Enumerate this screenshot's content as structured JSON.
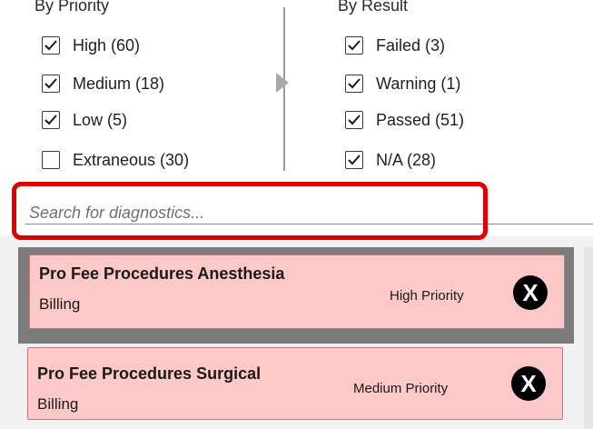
{
  "filters": {
    "priority": {
      "title": "By Priority",
      "items": [
        {
          "label": "High (60)",
          "checked": true
        },
        {
          "label": "Medium (18)",
          "checked": true
        },
        {
          "label": "Low (5)",
          "checked": true
        },
        {
          "label": "Extraneous (30)",
          "checked": false
        }
      ]
    },
    "result": {
      "title": "By Result",
      "items": [
        {
          "label": "Failed (3)",
          "checked": true
        },
        {
          "label": "Warning (1)",
          "checked": true
        },
        {
          "label": "Passed (51)",
          "checked": true
        },
        {
          "label": "N/A (28)",
          "checked": true
        }
      ]
    }
  },
  "search": {
    "placeholder": "Search for diagnostics..."
  },
  "highlight_color": "#e00000",
  "card_color": "#fcc8c8",
  "diagnostics": [
    {
      "title": "Pro Fee Procedures Anesthesia",
      "category": "Billing",
      "priority": "High Priority",
      "close_label": "X",
      "selected": true
    },
    {
      "title": "Pro Fee Procedures Surgical",
      "category": "Billing",
      "priority": "Medium Priority",
      "close_label": "X",
      "selected": false
    }
  ]
}
